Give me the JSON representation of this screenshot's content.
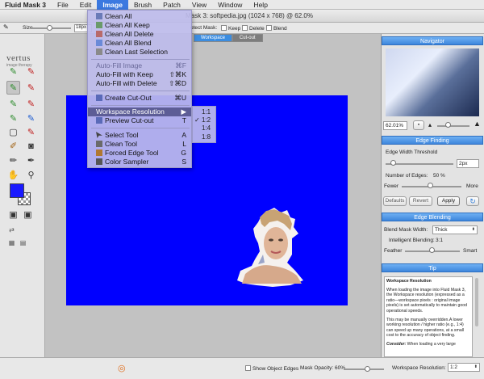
{
  "menubar": {
    "app": "Fluid Mask 3",
    "items": [
      "File",
      "Edit",
      "Image",
      "Brush",
      "Patch",
      "View",
      "Window",
      "Help"
    ],
    "active": "Image"
  },
  "window": {
    "title": "Mask 3: softpedia.jpg (1024 x 768) @ 62.0%"
  },
  "options": {
    "size_label": "Size",
    "size_value": "18px",
    "protect_mask": "otect Mask:",
    "keep": "Keep",
    "delete": "Delete",
    "blend": "Blend"
  },
  "logo": {
    "name": "vertus",
    "tagline": "image therapy"
  },
  "tabs": {
    "workspace": "Workspace",
    "cutout": "Cut-out"
  },
  "image_menu": {
    "clean_all": "Clean All",
    "clean_all_keep": "Clean All Keep",
    "clean_all_delete": "Clean All Delete",
    "clean_all_blend": "Clean All Blend",
    "clean_last": "Clean Last Selection",
    "autofill": "Auto-Fill Image",
    "autofill_sc": "⌘F",
    "autofill_keep": "Auto-Fill with Keep",
    "autofill_keep_sc": "⇧⌘K",
    "autofill_delete": "Auto-Fill with Delete",
    "autofill_delete_sc": "⇧⌘D",
    "create_cutout": "Create Cut-Out",
    "create_cutout_sc": "⌘U",
    "workspace_res": "Workspace Resolution",
    "workspace_res_arrow": "▶",
    "preview_cutout": "Preview Cut-out",
    "preview_cutout_sc": "T",
    "select_tool": "Select Tool",
    "select_tool_sc": "A",
    "clean_tool": "Clean Tool",
    "clean_tool_sc": "L",
    "forced_edge": "Forced Edge Tool",
    "forced_edge_sc": "G",
    "color_sampler": "Color Sampler",
    "color_sampler_sc": "S"
  },
  "res_submenu": {
    "items": [
      "1:1",
      "1:2",
      "1:4",
      "1:8"
    ],
    "checked": "1:2",
    "check": "✓"
  },
  "navigator": {
    "title": "Navigator",
    "zoom": "62.01%"
  },
  "edge_finding": {
    "title": "Edge Finding",
    "width_label": "Edge Width Threshold",
    "width_value": "2px",
    "edges_label": "Number of Edges:",
    "edges_value": "50 %",
    "fewer": "Fewer",
    "more": "More",
    "defaults": "Defaults",
    "revert": "Revert",
    "apply": "Apply"
  },
  "edge_blending": {
    "title": "Edge Blending",
    "mask_width_label": "Blend Mask Width:",
    "mask_width_value": "Thick",
    "intelligent_label": "Intelligent Blending:",
    "intelligent_value": "3:1",
    "feather": "Feather",
    "smart": "Smart"
  },
  "tip": {
    "title": "Tip",
    "heading": "Workspace Resolution",
    "p1": "When loading the image into Fluid Mask 3, the Workspace resolution (expressed as a ratio—workspace pixels : original image pixels) is set automatically to maintain good operational speeds.",
    "p2": "This may be manually overridden.A lower working resolution / higher ratio (e.g., 1:4) can speed up many operations, at a small cost to the accuracy of object finding.",
    "p3_em": "Consider:",
    "p3": " When loading a very large"
  },
  "status": {
    "show_edges": "Show Object Edges",
    "mask_opacity": "Mask Opacity: 60%",
    "ws_res_label": "Workspace Resolution:",
    "ws_res_value": "1:2"
  },
  "colors": {
    "canvas": "#0000ff",
    "menu_highlight": "#5d5d96",
    "panel_header": "#3d86dc"
  }
}
